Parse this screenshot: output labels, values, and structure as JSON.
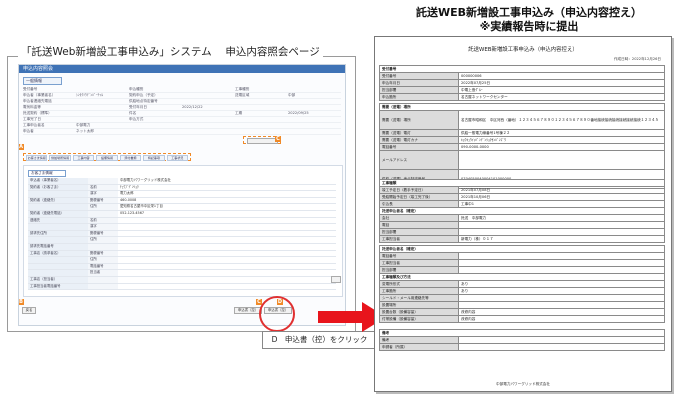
{
  "left": {
    "system_title": "「託送Web新増設工事申込み」システム　 申込内容照会ページ",
    "app_bar_title": "申込内容照会",
    "section_label": "一般情報",
    "info_rows": [
      [
        "受付番号",
        "",
        "申込種別",
        "",
        "工事種別",
        ""
      ],
      [
        "申込者（事業者名）",
        "ｼﾝﾀｸｿｳﾃﾞﾝﾊﾞｰﾁｬﾙ",
        "契約申込（予定）",
        "",
        "送電区域",
        "中部"
      ],
      [
        "申込者連絡先電話",
        "",
        "供給地点特定番号",
        "",
        "",
        ""
      ],
      [
        "電気料金等",
        "",
        "受付年月日",
        "2022/12/22",
        "",
        ""
      ],
      [
        "託送契約（標準）",
        "",
        "件名",
        "",
        "工期",
        "2022/09/25"
      ],
      [
        "工事完了日",
        "",
        "申込方式",
        "",
        "",
        ""
      ],
      [
        "工事申込者名",
        "中部電力",
        "",
        "",
        "",
        ""
      ],
      [
        "申込者",
        "ネット太郎",
        "",
        "",
        "",
        ""
      ]
    ],
    "marker_c": "C",
    "marker_a": "A",
    "marker_b": "B",
    "marker_d": "D",
    "tabs": [
      "お客さま情報",
      "供給場所情報",
      "工事内容",
      "設備情報",
      "添付書類",
      "特記事項",
      "工事状況"
    ],
    "detail_section_label": "お客さま情報",
    "detail_rows": [
      [
        "申込者（事業者名）",
        "",
        "中部電力パワーグリッド株式会社"
      ],
      [
        "契約者（お客さま）",
        "名前",
        "ﾁｭｳﾌﾞﾃﾞﾝﾘｮｸ"
      ],
      [
        "",
        "漢字",
        "電力太郎"
      ],
      [
        "契約者（連絡先）",
        "郵便番号",
        "460-0008"
      ],
      [
        "",
        "住所",
        "愛知県名古屋市中区栄1丁目"
      ],
      [
        "契約者（連絡先電話）",
        "",
        "052-123-4567"
      ],
      [
        "連絡先",
        "名前",
        ""
      ],
      [
        "",
        "漢字",
        ""
      ],
      [
        "請求先住所",
        "郵便番号",
        ""
      ],
      [
        "",
        "住所",
        ""
      ],
      [
        "請求先電話番号",
        "",
        ""
      ],
      [
        "工事店（請求者名）",
        "郵便番号",
        ""
      ],
      [
        "",
        "住所",
        ""
      ],
      [
        "",
        "電話番号",
        ""
      ],
      [
        "",
        "担当者",
        ""
      ],
      [
        "工事店（担当者）",
        "",
        ""
      ],
      [
        "工事担当者電話番号",
        "",
        ""
      ]
    ],
    "bottom_left_btn": "戻る",
    "bottom_btn_1": "申込書（控）",
    "bottom_btn_2": "申込書（控）",
    "label_d": "D　申込書（控）をクリック"
  },
  "right": {
    "title_line1": "託送WEB新増設工事申込み（申込内容控え）",
    "title_line2": "※実績報告時に提出",
    "doc_title": "託送WEB新増設工事申込み（申込内容控え）",
    "doc_date": "作成日時：2022年12月26日",
    "sections": [
      {
        "rows": [
          [
            "受付番号",
            ""
          ],
          [
            "受付番号",
            "000000006"
          ],
          [
            "申込年月日",
            "2022年07月25日"
          ],
          [
            "担当部署",
            "中電上島ｸﾞﾙｰ"
          ],
          [
            "申込箇所",
            "名古屋ネットワークセンター"
          ]
        ]
      },
      {
        "rows": [
          [
            "需要（送電）場所",
            ""
          ],
          [
            "需要（送電）場所",
            "名古屋市昭和区　中区河西（番地）１２３４５６７８９０１２３４５６７８９０番地接続接続接続接続接続接続１２３４５"
          ],
          [
            "需要（送電）電灯",
            "供給一般電力線番号1号棟２２"
          ],
          [
            "需要（送電）電灯カナ",
            "ｷｮｳｷｭｳｲｯﾊﾟﾝﾃﾞﾝﾘｮｸｾﾝﾊﾞﾝｺﾞｳ"
          ],
          [
            "電話番号",
            "090-0000-0000"
          ],
          [
            "メールアドレス",
            ""
          ],
          [
            "供給（送電）地点特定番号",
            "0704050040004101000000"
          ]
        ]
      },
      {
        "rows": [
          [
            "工事種類",
            ""
          ],
          [
            "竣工予定日（着手予定日）",
            "2021年07月08日"
          ],
          [
            "受給開始予定日（竣工完了後）",
            "2021年10月06日"
          ],
          [
            "引込長",
            "工事中1"
          ]
        ]
      },
      {
        "rows": [
          [
            "託送申込者名（確定）",
            ""
          ],
          [
            "会社",
            "託送　中部電力"
          ],
          [
            "電話",
            ""
          ],
          [
            "担当部署",
            ""
          ],
          [
            "工事担当者",
            "新電力（株）０１７"
          ]
        ]
      },
      {
        "rows": [
          [
            "託送申込者名（確定）",
            ""
          ],
          [
            "電話番号",
            ""
          ],
          [
            "工事担当者",
            ""
          ],
          [
            "担当部署",
            ""
          ]
        ]
      },
      {
        "rows": [
          [
            "工事種類及び方法",
            ""
          ],
          [
            "変電所形式",
            "あり"
          ],
          [
            "工事箇所",
            "あり"
          ],
          [
            "シールド・メール用連絡先等",
            ""
          ],
          [
            "設置場所",
            ""
          ],
          [
            "設置台数（設備容量）",
            "改修内容"
          ],
          [
            "付帯設備（設備容量）",
            "改修内容"
          ]
        ]
      },
      {
        "rows": [
          [
            "備考",
            ""
          ],
          [
            "備考",
            ""
          ],
          [
            "申請者（所属）",
            ""
          ]
        ]
      }
    ],
    "doc_footer": "中部電力パワーグリッド株式会社"
  }
}
